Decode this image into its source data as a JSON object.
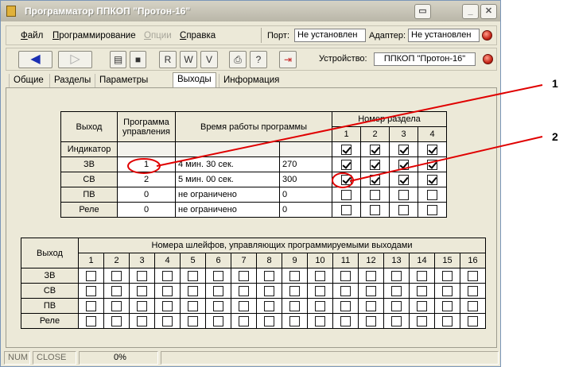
{
  "window": {
    "title": "Программатор ППКОП \"Протон-16\""
  },
  "menu": [
    {
      "label": "Файл",
      "ul": "Ф",
      "rest": "айл",
      "disabled": false
    },
    {
      "label": "Программирование",
      "ul": "П",
      "rest": "рограммирование",
      "disabled": false
    },
    {
      "label": "Опции",
      "ul": "О",
      "rest": "пции",
      "disabled": true
    },
    {
      "label": "Справка",
      "ul": "С",
      "rest": "правка",
      "disabled": false
    }
  ],
  "port": {
    "label": "Порт:",
    "value": "Не установлен"
  },
  "adapter": {
    "label": "Адаптер:",
    "value": "Не установлен"
  },
  "device": {
    "label": "Устройство:",
    "value": "ППКОП \"Протон-16\""
  },
  "toolbar_icons": [
    "back-arrow-icon",
    "forward-arrow-icon",
    "open-folder-icon",
    "save-disk-icon",
    "read-device-icon",
    "write-device-icon",
    "verify-device-icon",
    "print-icon",
    "help-icon",
    "exit-icon"
  ],
  "tabs": [
    "Общие",
    "Разделы",
    "Параметры ШС",
    "Выходы",
    "Информация"
  ],
  "active_tab": "Выходы",
  "outputs_table": {
    "headers": {
      "output": "Выход",
      "program": "Программа управления",
      "program_l1": "Программа",
      "program_l2": "управления",
      "time": "Время работы программы",
      "section": "Номер раздела",
      "section_numbers": [
        "1",
        "2",
        "3",
        "4"
      ]
    },
    "rows": [
      {
        "name": "Индикатор",
        "program": "",
        "time_text": "",
        "time_value": "",
        "sections": [
          true,
          true,
          true,
          true
        ]
      },
      {
        "name": "ЗВ",
        "program": "1",
        "time_text": "4 мин. 30 сек.",
        "time_value": "270",
        "sections": [
          true,
          true,
          true,
          true
        ]
      },
      {
        "name": "СВ",
        "program": "2",
        "time_text": "5 мин. 00 сек.",
        "time_value": "300",
        "sections": [
          true,
          true,
          true,
          true
        ]
      },
      {
        "name": "ПВ",
        "program": "0",
        "time_text": "не ограничено",
        "time_value": "0",
        "sections": [
          false,
          false,
          false,
          false
        ]
      },
      {
        "name": "Реле",
        "program": "0",
        "time_text": "не ограничено",
        "time_value": "0",
        "sections": [
          false,
          false,
          false,
          false
        ]
      }
    ]
  },
  "loops_table": {
    "header_output": "Выход",
    "header_loops": "Номера шлейфов, управляющих программируемыми выходами",
    "loop_numbers": [
      "1",
      "2",
      "3",
      "4",
      "5",
      "6",
      "7",
      "8",
      "9",
      "10",
      "11",
      "12",
      "13",
      "14",
      "15",
      "16"
    ],
    "rows": [
      "ЗВ",
      "СВ",
      "ПВ",
      "Реле"
    ]
  },
  "annotations": [
    "1",
    "2"
  ],
  "annotation_color": "#e00000",
  "statusbar": {
    "num": "NUM",
    "close": "CLOSE",
    "progress": "0%"
  }
}
